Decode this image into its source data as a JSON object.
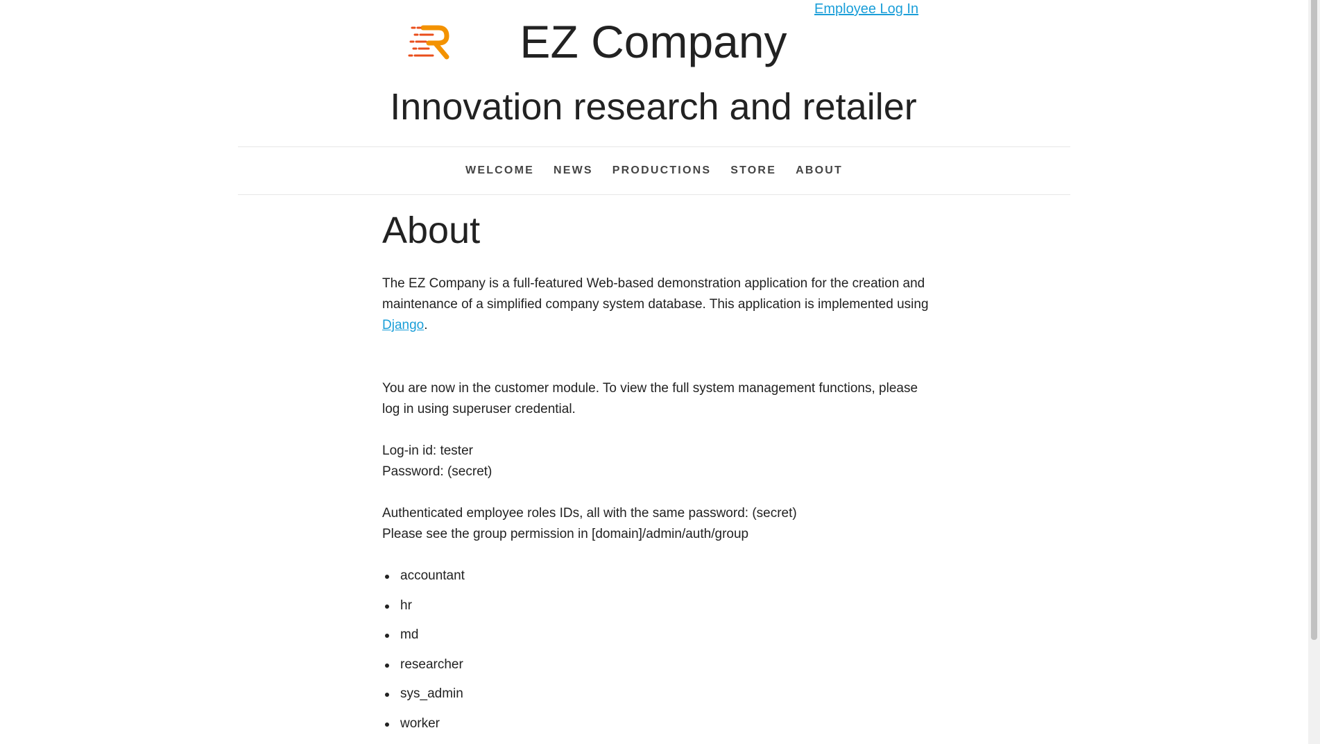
{
  "header": {
    "employee_login": "Employee Log In",
    "logo_icon": "r-speed-logo-icon",
    "brand_colors": [
      "#e94e1b",
      "#f39200"
    ],
    "site_title": "EZ Company",
    "tagline": "Innovation research and retailer"
  },
  "nav": {
    "items": [
      {
        "label": "WELCOME"
      },
      {
        "label": "NEWS"
      },
      {
        "label": "PRODUCTIONS"
      },
      {
        "label": "STORE"
      },
      {
        "label": "ABOUT"
      }
    ]
  },
  "main": {
    "heading": "About",
    "intro_before_link": "The EZ Company is a full-featured Web-based demonstration application for the creation and maintenance of a simplified company system database. This application is implemented using ",
    "intro_link": "Django",
    "intro_after_link": ".",
    "module_note": "You are now in the customer module. To view the full system management functions, please log in using superuser credential.",
    "login_id": "Log-in id: tester",
    "password": "Password: (secret)",
    "roles_note": "Authenticated employee roles IDs, all with the same password: (secret)",
    "group_note": "Please see the group permission in [domain]/admin/auth/group",
    "roles": [
      "accountant",
      "hr",
      "md",
      "researcher",
      "sys_admin",
      "worker"
    ]
  },
  "colors": {
    "link": "#1a9ed8",
    "text": "#222222",
    "nav_text": "#444444"
  }
}
